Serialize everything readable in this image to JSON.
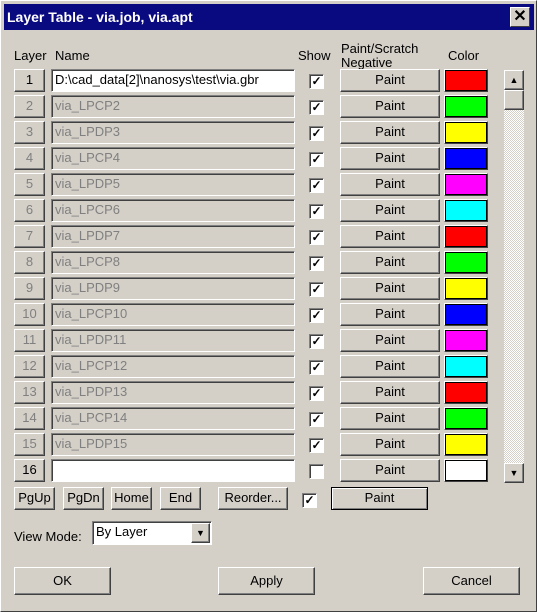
{
  "window": {
    "title": "Layer Table - via.job, via.apt",
    "close_label": "✕"
  },
  "headers": {
    "layer": "Layer",
    "name": "Name",
    "show": "Show",
    "paint_line1": "Paint/Scratch",
    "paint_line2": "Negative",
    "color": "Color"
  },
  "rows": [
    {
      "layer": "1",
      "name": "D:\\cad_data[2]\\nanosys\\test\\via.gbr",
      "enabled": true,
      "show": true,
      "mode": "Paint",
      "color": "#ff0000"
    },
    {
      "layer": "2",
      "name": "via_LPCP2",
      "enabled": false,
      "show": true,
      "mode": "Paint",
      "color": "#00ff00"
    },
    {
      "layer": "3",
      "name": "via_LPDP3",
      "enabled": false,
      "show": true,
      "mode": "Paint",
      "color": "#ffff00"
    },
    {
      "layer": "4",
      "name": "via_LPCP4",
      "enabled": false,
      "show": true,
      "mode": "Paint",
      "color": "#0000ff"
    },
    {
      "layer": "5",
      "name": "via_LPDP5",
      "enabled": false,
      "show": true,
      "mode": "Paint",
      "color": "#ff00ff"
    },
    {
      "layer": "6",
      "name": "via_LPCP6",
      "enabled": false,
      "show": true,
      "mode": "Paint",
      "color": "#00ffff"
    },
    {
      "layer": "7",
      "name": "via_LPDP7",
      "enabled": false,
      "show": true,
      "mode": "Paint",
      "color": "#ff0000"
    },
    {
      "layer": "8",
      "name": "via_LPCP8",
      "enabled": false,
      "show": true,
      "mode": "Paint",
      "color": "#00ff00"
    },
    {
      "layer": "9",
      "name": "via_LPDP9",
      "enabled": false,
      "show": true,
      "mode": "Paint",
      "color": "#ffff00"
    },
    {
      "layer": "10",
      "name": "via_LPCP10",
      "enabled": false,
      "show": true,
      "mode": "Paint",
      "color": "#0000ff"
    },
    {
      "layer": "11",
      "name": "via_LPDP11",
      "enabled": false,
      "show": true,
      "mode": "Paint",
      "color": "#ff00ff"
    },
    {
      "layer": "12",
      "name": "via_LPCP12",
      "enabled": false,
      "show": true,
      "mode": "Paint",
      "color": "#00ffff"
    },
    {
      "layer": "13",
      "name": "via_LPDP13",
      "enabled": false,
      "show": true,
      "mode": "Paint",
      "color": "#ff0000"
    },
    {
      "layer": "14",
      "name": "via_LPCP14",
      "enabled": false,
      "show": true,
      "mode": "Paint",
      "color": "#00ff00"
    },
    {
      "layer": "15",
      "name": "via_LPDP15",
      "enabled": false,
      "show": true,
      "mode": "Paint",
      "color": "#ffff00"
    },
    {
      "layer": "16",
      "name": "",
      "enabled": true,
      "show": false,
      "mode": "Paint",
      "color": "#ffffff"
    }
  ],
  "nav": {
    "pgup": "PgUp",
    "pgdn": "PgDn",
    "home": "Home",
    "end": "End",
    "reorder": "Reorder...",
    "all_show": true,
    "all_mode": "Paint"
  },
  "view_mode": {
    "label": "View Mode:",
    "value": "By Layer"
  },
  "footer": {
    "ok": "OK",
    "apply": "Apply",
    "cancel": "Cancel"
  },
  "scrollbar": {
    "up": "▲",
    "down": "▼",
    "position": 0
  }
}
